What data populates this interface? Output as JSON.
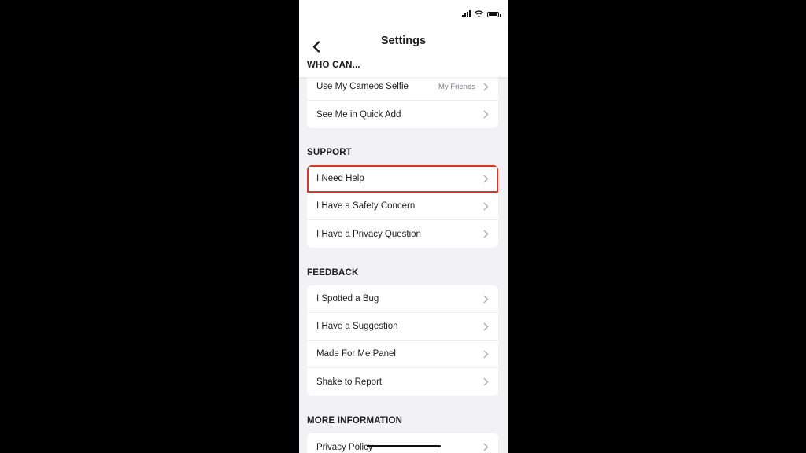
{
  "header": {
    "title": "Settings"
  },
  "sections": [
    {
      "header": "WHO CAN...",
      "rows": [
        {
          "label": "Use My Cameos Selfie",
          "value": "My Friends"
        },
        {
          "label": "See Me in Quick Add"
        }
      ]
    },
    {
      "header": "SUPPORT",
      "rows": [
        {
          "label": "I Need Help",
          "highlighted": true
        },
        {
          "label": "I Have a Safety Concern"
        },
        {
          "label": "I Have a Privacy Question"
        }
      ]
    },
    {
      "header": "FEEDBACK",
      "rows": [
        {
          "label": "I Spotted a Bug"
        },
        {
          "label": "I Have a Suggestion"
        },
        {
          "label": "Made For Me Panel"
        },
        {
          "label": "Shake to Report"
        }
      ]
    },
    {
      "header": "MORE INFORMATION",
      "rows": [
        {
          "label": "Privacy Policy"
        }
      ]
    }
  ],
  "colors": {
    "highlight": "#d9362b",
    "background": "#f2f2f4"
  },
  "icons": [
    "back-chevron-icon",
    "chevron-right-icon",
    "signal-icon",
    "wifi-icon",
    "battery-icon"
  ]
}
